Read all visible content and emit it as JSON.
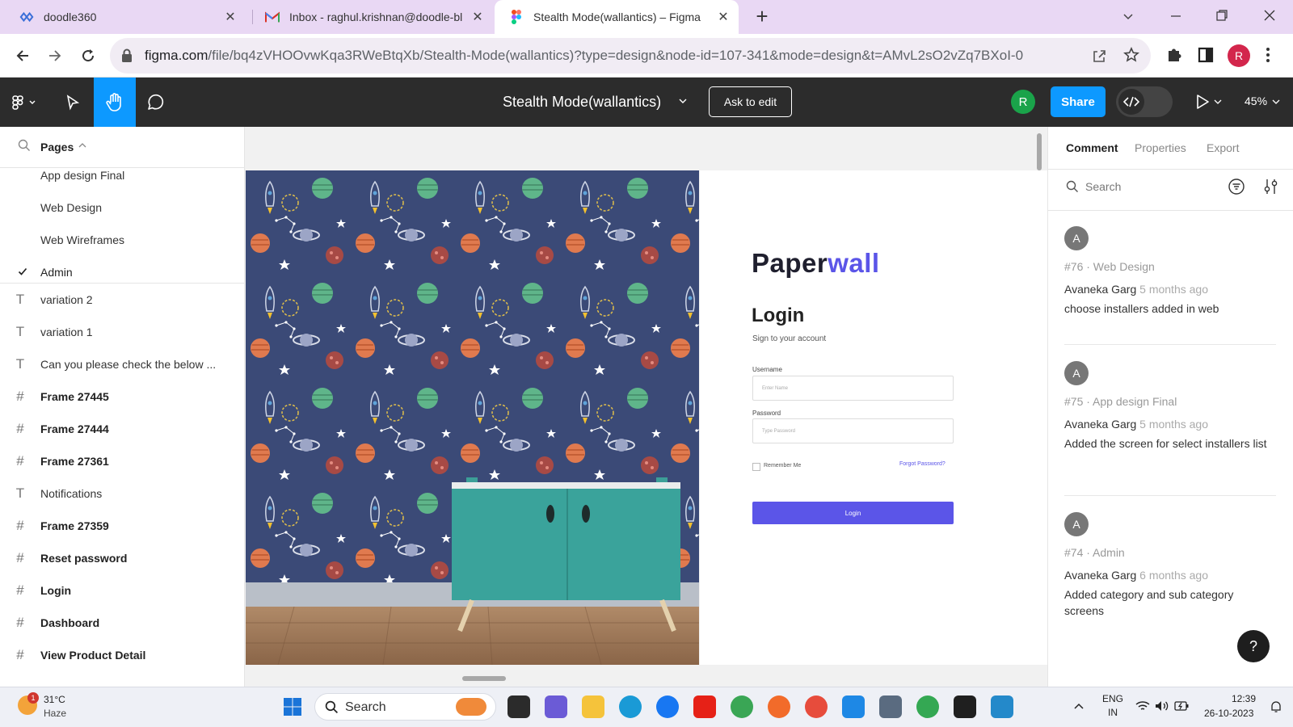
{
  "browser": {
    "tabs": [
      {
        "title": "doodle360",
        "icon": "doodle360-icon",
        "active": false
      },
      {
        "title": "Inbox - raghul.krishnan@doodle-bl",
        "icon": "gmail-icon",
        "active": false
      },
      {
        "title": "Stealth Mode(wallantics) – Figma",
        "icon": "figma-icon",
        "active": true
      }
    ],
    "new_tab_label": "+",
    "url_host": "figma.com",
    "url_path": "/file/bq4zVHOOvwKqa3RWeBtqXb/Stealth-Mode(wallantics)?type=design&node-id=107-341&mode=design&t=AMvL2sO2vZq7BXoI-0",
    "profile_initial": "R"
  },
  "figma": {
    "file_title": "Stealth Mode(wallantics)",
    "ask_to_edit": "Ask to edit",
    "share": "Share",
    "zoom": "45%",
    "user_initial": "R",
    "accent": "#0d99ff"
  },
  "left_panel": {
    "pages_label": "Pages",
    "pages": [
      "App design Final",
      "Web Design",
      "Web Wireframes",
      "Admin"
    ],
    "current_page": "Admin",
    "layers": [
      {
        "type": "text",
        "name": "variation 2"
      },
      {
        "type": "text",
        "name": "variation 1"
      },
      {
        "type": "text",
        "name": "Can you please check the below ..."
      },
      {
        "type": "frame",
        "name": "Frame 27445"
      },
      {
        "type": "frame",
        "name": "Frame 27444"
      },
      {
        "type": "frame",
        "name": "Frame 27361"
      },
      {
        "type": "text",
        "name": "Notifications"
      },
      {
        "type": "frame",
        "name": "Frame 27359"
      },
      {
        "type": "frame",
        "name": "Reset password"
      },
      {
        "type": "frame",
        "name": "Login"
      },
      {
        "type": "frame",
        "name": "Dashboard"
      },
      {
        "type": "frame",
        "name": "View Product Detail"
      }
    ]
  },
  "canvas": {
    "brand_a": "Paper",
    "brand_b": "wall",
    "login_title": "Login",
    "login_subtitle": "Sign to your account",
    "username_label": "Username",
    "username_placeholder": "Enter Name",
    "password_label": "Password",
    "password_placeholder": "Type Password",
    "remember_me": "Remember Me",
    "forgot_password": "Forgot Password?",
    "login_button": "Login",
    "brand_color": "#5b55e8"
  },
  "right_panel": {
    "tabs": [
      "Comment",
      "Properties",
      "Export"
    ],
    "active_tab": "Comment",
    "search_placeholder": "Search",
    "comments": [
      {
        "avatar": "A",
        "meta": "#76 · Web Design",
        "author": "Avaneka Garg",
        "ago": "5 months ago",
        "text": "choose installers added in web"
      },
      {
        "avatar": "A",
        "meta": "#75 · App design Final",
        "author": "Avaneka Garg",
        "ago": "5 months ago",
        "text": "Added the screen for select installers list"
      },
      {
        "avatar": "A",
        "meta": "#74 · Admin",
        "author": "Avaneka Garg",
        "ago": "6 months ago",
        "text": "Added category and sub category screens"
      }
    ],
    "help_label": "?"
  },
  "taskbar": {
    "weather_temp": "31°C",
    "weather_desc": "Haze",
    "weather_badge": "1",
    "search_label": "Search",
    "lang_top": "ENG",
    "lang_bottom": "IN",
    "time": "12:39",
    "date": "26-10-2023"
  }
}
